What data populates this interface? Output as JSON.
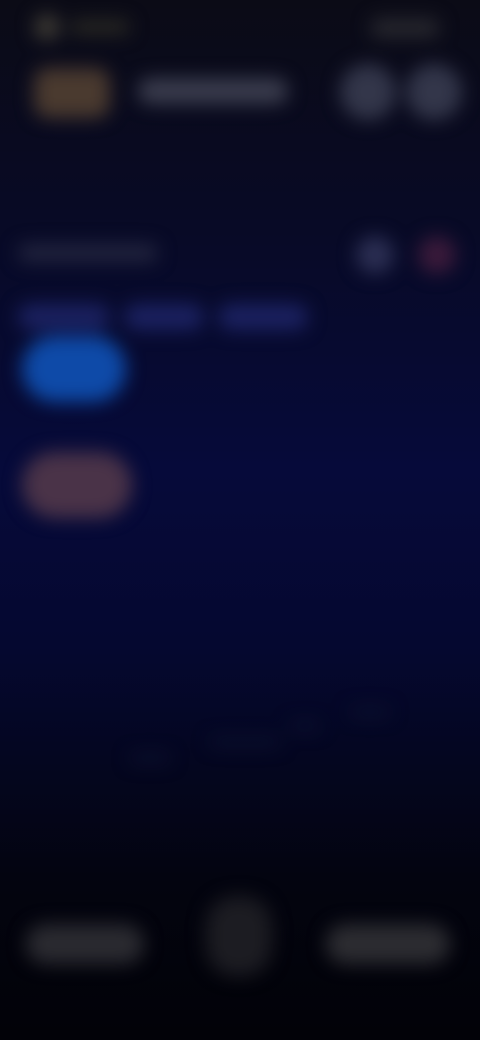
{
  "theme": {
    "background_top": "#0b0b16",
    "background_mid": "#060a3a",
    "background_bottom": "#020208",
    "accent_blue": "#0e4aa8",
    "accent_rose": "#4a3348"
  },
  "screen_state": "blurred",
  "icons": {
    "status": "status-indicator",
    "header_actions": [
      "round-action-icon",
      "round-action-icon"
    ],
    "section_actions": [
      "round-action-icon",
      "round-action-icon"
    ],
    "bottom_center": "center-action-icon"
  },
  "header": {
    "title": ""
  },
  "section": {
    "label": ""
  },
  "tabs": [
    "",
    "",
    ""
  ],
  "cards": [
    "",
    ""
  ],
  "bottom_bar": {
    "left_label": "",
    "right_label": ""
  }
}
